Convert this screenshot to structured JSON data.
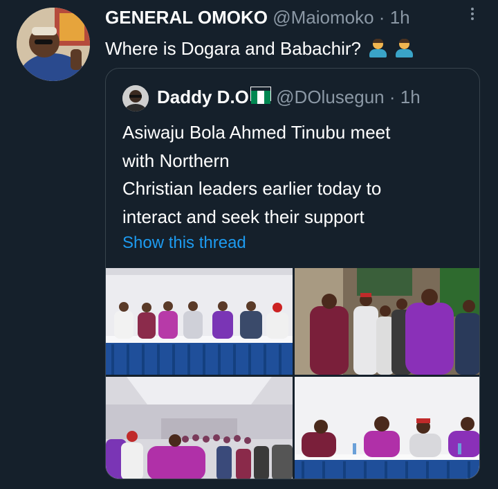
{
  "tweet": {
    "author_name": "GENERAL OMOKO",
    "author_handle": "@Maiomoko",
    "separator": "·",
    "time": "1h",
    "text": "Where is Dogara and Babachir?",
    "emojis": [
      "person-shrugging",
      "person-shrugging"
    ]
  },
  "quote": {
    "author_name": "Daddy D.O",
    "author_flag": "nigeria-flag",
    "author_handle": "@DOlusegun",
    "separator": "·",
    "time": "1h",
    "text_lines": [
      "Asiwaju Bola Ahmed Tinubu meet",
      "with Northern",
      "Christian leaders earlier today to",
      "interact and seek their support"
    ],
    "thread_link": "Show this thread",
    "photos": [
      "photo-group-standing-at-table",
      "photo-tinubu-greeting-bishop",
      "photo-conference-hall-crowd",
      "photo-leaders-seated-at-table"
    ]
  },
  "colors": {
    "background": "#15202b",
    "text_primary": "#ffffff",
    "text_secondary": "#8b98a5",
    "link": "#1d9bf0",
    "border": "#38444d",
    "flag_green": "#008751",
    "flag_white": "#ffffff"
  }
}
